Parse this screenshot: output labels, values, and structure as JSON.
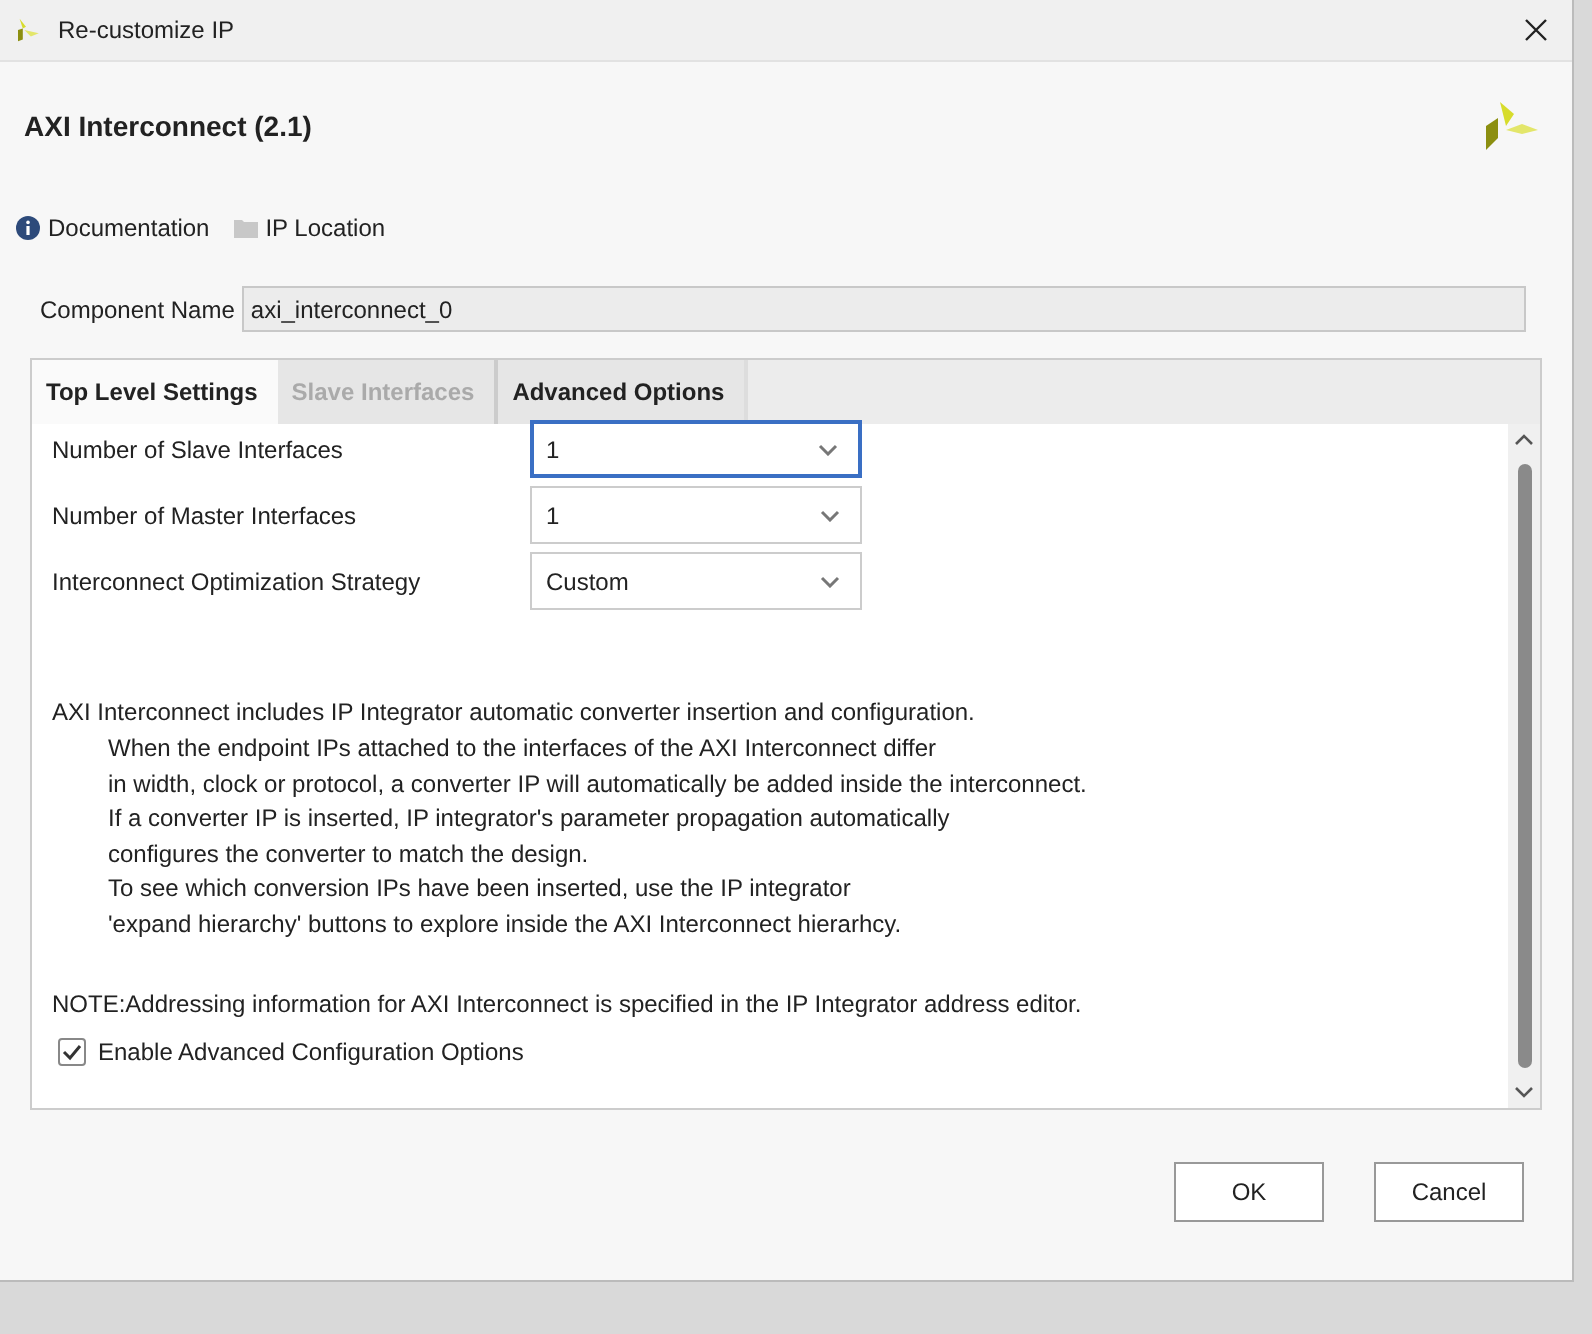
{
  "window": {
    "title": "Re-customize IP"
  },
  "header": {
    "title": "AXI Interconnect (2.1)"
  },
  "links": [
    {
      "kind": "info",
      "label": "Documentation"
    },
    {
      "kind": "folder",
      "label": "IP Location"
    }
  ],
  "component_name": {
    "label": "Component Name",
    "value": "axi_interconnect_0"
  },
  "tabs": [
    {
      "label": "Top Level Settings",
      "selected": true,
      "disabled": false
    },
    {
      "label": "Slave Interfaces",
      "selected": false,
      "disabled": true
    },
    {
      "label": "Advanced Options",
      "selected": false,
      "disabled": false
    }
  ],
  "settings": [
    {
      "label": "Number of Slave Interfaces",
      "value": "1",
      "focused": true
    },
    {
      "label": "Number of Master Interfaces",
      "value": "1",
      "focused": false
    },
    {
      "label": "Interconnect Optimization Strategy",
      "value": "Custom",
      "focused": false
    }
  ],
  "description": {
    "intro": "AXI Interconnect includes IP Integrator automatic converter insertion and configuration.",
    "lines": [
      "When the endpoint IPs attached to the interfaces of the AXI Interconnect differ",
      "in width, clock or protocol, a converter IP will automatically be added inside the interconnect.",
      "If a converter IP is inserted, IP integrator's parameter propagation automatically",
      "configures the converter to match the design.",
      "To see which conversion IPs have been inserted, use the IP integrator",
      "'expand hierarchy' buttons to explore inside the AXI Interconnect hierarhcy."
    ],
    "note": "NOTE:Addressing information for AXI Interconnect is specified in the IP Integrator address editor."
  },
  "advanced_checkbox": {
    "label": "Enable Advanced Configuration Options",
    "checked": true
  },
  "buttons": [
    "OK",
    "Cancel"
  ]
}
